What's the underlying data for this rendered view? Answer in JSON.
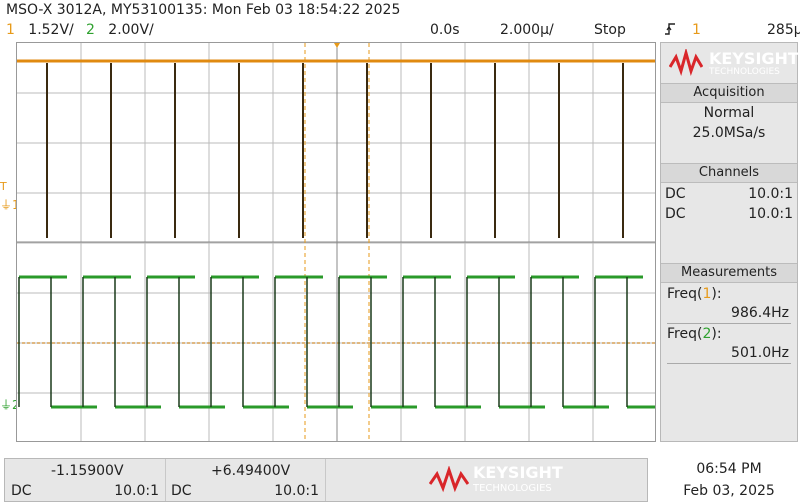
{
  "header": {
    "title": "MSO-X 3012A, MY53100135: Mon Feb 03 18:54:22 2025",
    "ch1": {
      "num": "1",
      "scale": "1.52V/"
    },
    "ch2": {
      "num": "2",
      "scale": "2.00V/"
    },
    "delay": "0.0s",
    "timebase": "2.000µ/",
    "run_status": "Stop",
    "trigger": {
      "icon": "rising-edge-icon",
      "source": "1",
      "level": "285µ"
    }
  },
  "channel_markers": {
    "ch1": "1",
    "ch2": "2"
  },
  "panel": {
    "brand": "KEYSIGHT",
    "brand_sub": "TECHNOLOGIES",
    "acquisition": {
      "title": "Acquisition",
      "mode": "Normal",
      "rate": "25.0MSa/s"
    },
    "channels": {
      "title": "Channels",
      "rows": [
        {
          "coupling": "DC",
          "probe": "10.0:1",
          "color": "#e79a1a"
        },
        {
          "coupling": "DC",
          "probe": "10.0:1",
          "color": "#2fa12f"
        }
      ]
    },
    "measurements": {
      "title": "Measurements",
      "items": [
        {
          "label": "Freq(",
          "ch": "1",
          "close": "):",
          "value": "986.4Hz"
        },
        {
          "label": "Freq(",
          "ch": "2",
          "close": "):",
          "value": "501.0Hz"
        }
      ]
    }
  },
  "bottom": {
    "ch1": {
      "offset": "-1.15900V",
      "coupling": "DC",
      "probe": "10.0:1"
    },
    "ch2": {
      "offset": "+6.49400V",
      "coupling": "DC",
      "probe": "10.0:1"
    },
    "brand": "KEYSIGHT",
    "brand_sub": "TECHNOLOGIES",
    "time": "06:54 PM",
    "date": "Feb 03, 2025"
  },
  "colors": {
    "ch1": "#e79a1a",
    "ch2": "#2fa12f",
    "brand": "#d9262a"
  }
}
